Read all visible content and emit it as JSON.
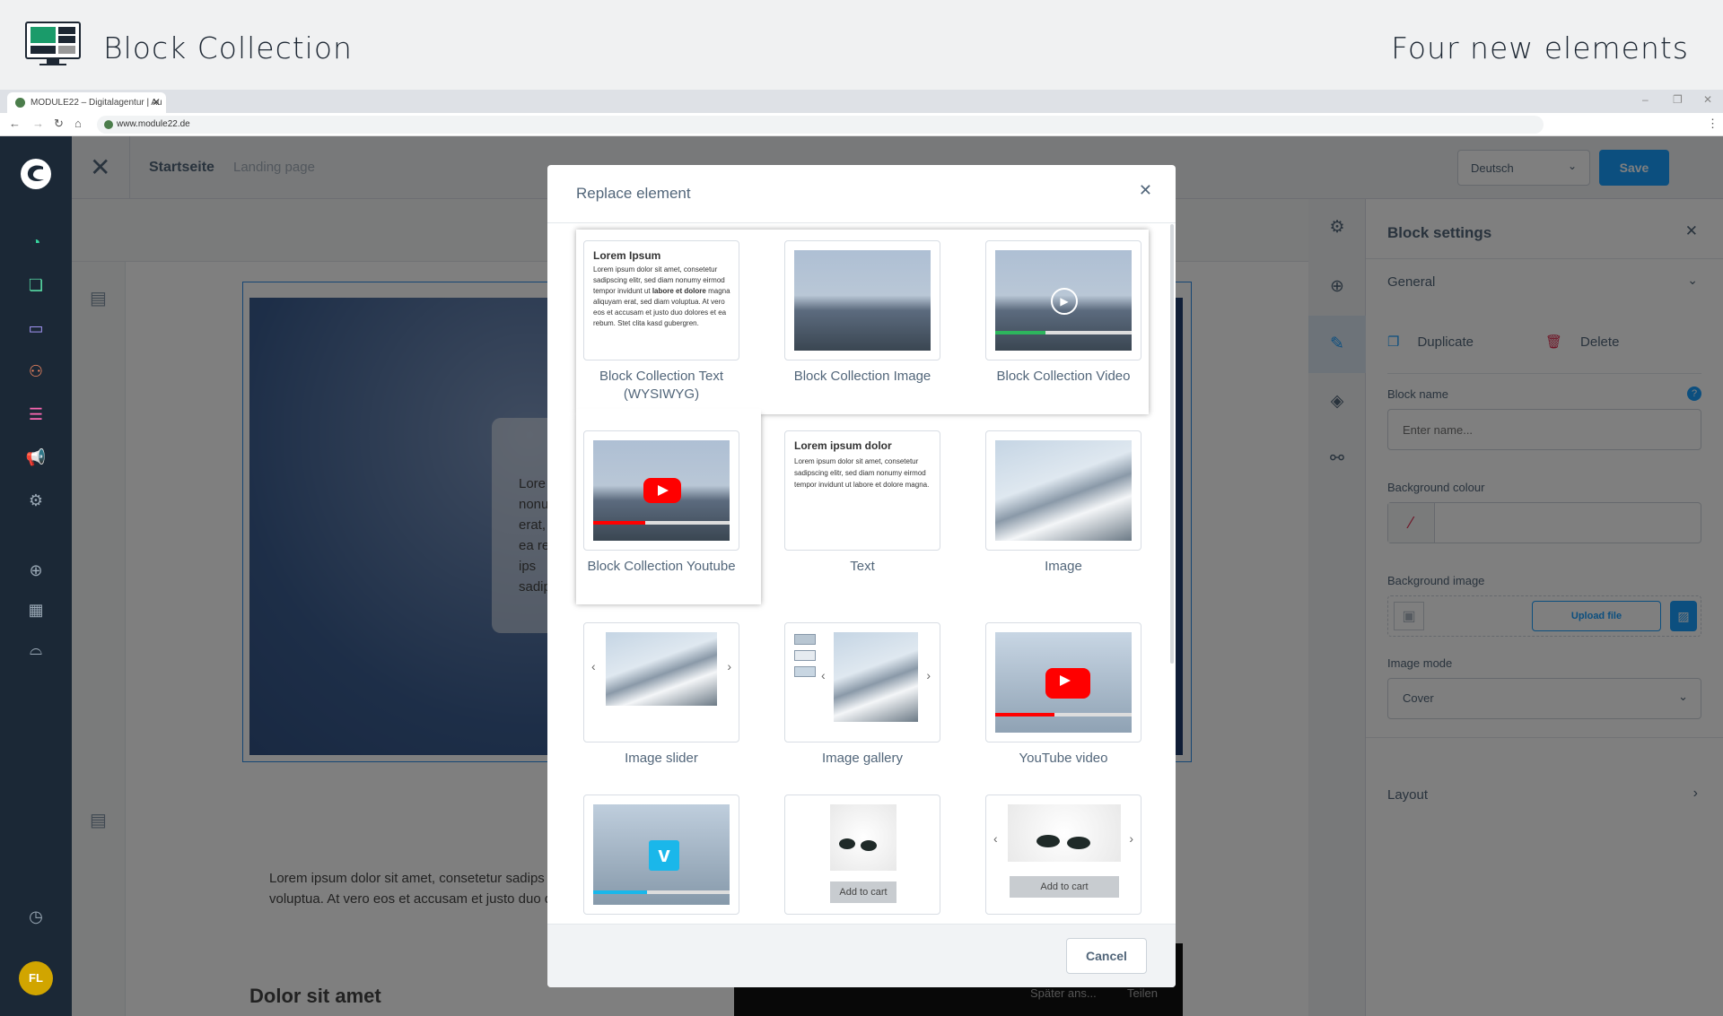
{
  "banner": {
    "title": "Block Collection",
    "subtitle": "Four new elements"
  },
  "browser": {
    "tab_title": "MODULE22 – Digitalagentur | Au",
    "url": "www.module22.de"
  },
  "topbar": {
    "crumb_primary": "Startseite",
    "crumb_secondary": "Landing page",
    "language": "Deutsch",
    "save_label": "Save"
  },
  "user": {
    "initials": "FL"
  },
  "canvas": {
    "skybox_lines": [
      "Lore",
      "nonum",
      "erat, se",
      "ea rebu",
      "ips",
      "sadipsc"
    ],
    "paragraph": "Lorem ipsum dolor sit amet, consetetur sadips voluptua. At vero eos et accusam et justo duo d",
    "heading": "Dolor sit amet",
    "video_later": "Später ans...",
    "video_share": "Teilen"
  },
  "panel": {
    "title": "Block settings",
    "general": "General",
    "duplicate": "Duplicate",
    "delete": "Delete",
    "block_name_label": "Block name",
    "block_name_placeholder": "Enter name...",
    "bg_colour_label": "Background colour",
    "bg_image_label": "Background image",
    "upload_label": "Upload file",
    "image_mode_label": "Image mode",
    "image_mode_value": "Cover",
    "layout": "Layout"
  },
  "modal": {
    "title": "Replace element",
    "cancel": "Cancel",
    "elements": [
      {
        "label": "Block Collection Text (WYSIWYG)"
      },
      {
        "label": "Block Collection Image"
      },
      {
        "label": "Block Collection Video"
      },
      {
        "label": "Block Collection Youtube"
      },
      {
        "label": "Text"
      },
      {
        "label": "Image"
      },
      {
        "label": "Image slider"
      },
      {
        "label": "Image gallery"
      },
      {
        "label": "YouTube video"
      },
      {
        "label": ""
      },
      {
        "label": ""
      },
      {
        "label": ""
      }
    ],
    "preview_text1_title": "Lorem Ipsum",
    "preview_text1_body_a": "Lorem ipsum dolor sit amet, consetetur sadipscing elitr, sed diam nonumy eirmod tempor invidunt ut",
    "preview_text1_bold": "labore et dolore",
    "preview_text1_body_b": "magna aliquyam erat, sed diam voluptua. At vero eos et accusam et justo duo dolores et ea rebum. Stet clita kasd gubergren.",
    "preview_text2_title": "Lorem ipsum dolor",
    "preview_text2_body": "Lorem ipsum dolor sit amet, consetetur sadipscing elitr, sed diam nonumy eirmod tempor invidunt ut labore et dolore magna.",
    "add_to_cart": "Add to cart"
  }
}
